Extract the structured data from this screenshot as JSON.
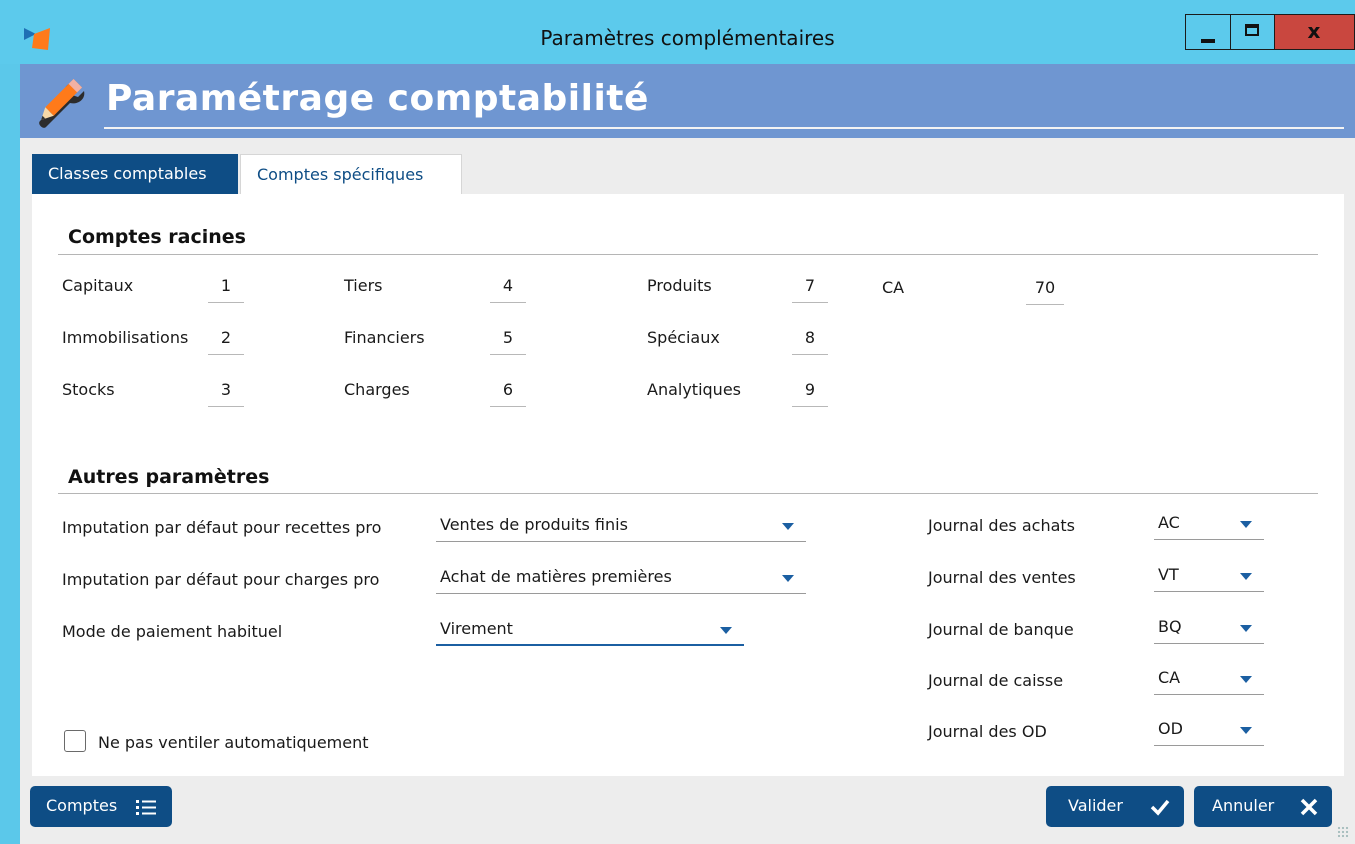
{
  "window": {
    "title": "Paramètres complémentaires",
    "close_glyph": "x"
  },
  "header": {
    "title": "Paramétrage comptabilité",
    "icon": "tools-icon"
  },
  "tabs": [
    {
      "label": "Classes comptables",
      "active": true
    },
    {
      "label": "Comptes spécifiques",
      "active": false
    }
  ],
  "comptes_racines": {
    "title": "Comptes racines",
    "items": [
      {
        "label": "Capitaux",
        "value": "1"
      },
      {
        "label": "Immobilisations",
        "value": "2"
      },
      {
        "label": "Stocks",
        "value": "3"
      },
      {
        "label": "Tiers",
        "value": "4"
      },
      {
        "label": "Financiers",
        "value": "5"
      },
      {
        "label": "Charges",
        "value": "6"
      },
      {
        "label": "Produits",
        "value": "7"
      },
      {
        "label": "Spéciaux",
        "value": "8"
      },
      {
        "label": "Analytiques",
        "value": "9"
      },
      {
        "label": "CA",
        "value": "70"
      }
    ]
  },
  "autres": {
    "title": "Autres paramètres",
    "fields": [
      {
        "label": "Imputation par défaut pour recettes pro",
        "value": "Ventes de produits finis"
      },
      {
        "label": "Imputation par défaut pour charges pro",
        "value": "Achat de matières premières"
      },
      {
        "label": "Mode de paiement habituel",
        "value": "Virement"
      }
    ],
    "journals": [
      {
        "label": "Journal des achats",
        "value": "AC"
      },
      {
        "label": "Journal des ventes",
        "value": "VT"
      },
      {
        "label": "Journal de banque",
        "value": "BQ"
      },
      {
        "label": "Journal de caisse",
        "value": "CA"
      },
      {
        "label": "Journal des OD",
        "value": "OD"
      }
    ],
    "checkbox_label": "Ne pas ventiler automatiquement",
    "checkbox_checked": false
  },
  "footer": {
    "comptes_label": "Comptes",
    "valider_label": "Valider",
    "annuler_label": "Annuler"
  },
  "colors": {
    "titlebar": "#5ccaec",
    "header": "#6f96d1",
    "accent": "#0e4d85",
    "close": "#c9473f"
  }
}
